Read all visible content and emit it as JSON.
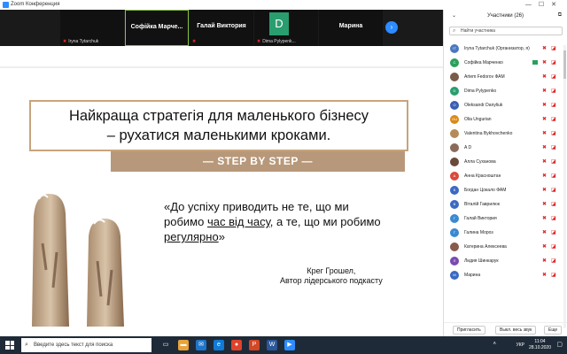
{
  "window": {
    "title": "Zoom Конференция"
  },
  "video_strip": {
    "tiles": [
      {
        "name": "",
        "sub": "Iryna Tytarchuk"
      },
      {
        "name": "Софійка Марче...",
        "sub": ""
      },
      {
        "name": "Галай Виктория",
        "sub": ""
      },
      {
        "name": "",
        "sub": "Dima Pylypenk...",
        "avatar": "D"
      },
      {
        "name": "Марина",
        "sub": ""
      }
    ],
    "next_icon": "›"
  },
  "slide": {
    "headline_line1": "Найкраща стратегія для маленького бізнесу",
    "headline_line2": "–  рухатися маленькими кроками.",
    "step_text": "— STEP BY STEP —",
    "quote_part1": "«До успіху приводить не те, що ми робимо ",
    "quote_u1": "час від часу",
    "quote_part2": ", а те, що ми робимо ",
    "quote_u2": "регулярно",
    "quote_part3": "»",
    "author_name": "Крег Грошел,",
    "author_title": "Автор лідерського подкасту"
  },
  "panel": {
    "title": "Участники (26)",
    "search_placeholder": "Найти участника",
    "participants": [
      {
        "initials": "IT",
        "name": "Iryna Tytarchuk (Организатор, я)",
        "color": "#4a78c2",
        "cam": false
      },
      {
        "initials": "С",
        "name": "Софійка Марченко",
        "color": "#2aa05b",
        "cam": true
      },
      {
        "initials": "",
        "name": "Artem Fedorov ФАМ",
        "color": "#7a5a48",
        "cam": false
      },
      {
        "initials": "D",
        "name": "Dima Pylypenko",
        "color": "#2a9d6f",
        "cam": false
      },
      {
        "initials": "O",
        "name": "Oleksandr Danyliuk",
        "color": "#3a5fb0",
        "cam": false
      },
      {
        "initials": "OU",
        "name": "Olia Ungurian",
        "color": "#d98a1a",
        "cam": false
      },
      {
        "initials": "",
        "name": "Valentina Bykhovchenko",
        "color": "#b58a5a",
        "cam": false
      },
      {
        "initials": "",
        "name": "A D",
        "color": "#8a6a5a",
        "cam": false
      },
      {
        "initials": "",
        "name": "Алла Суханова",
        "color": "#6a4a3a",
        "cam": false
      },
      {
        "initials": "А",
        "name": "Анна Красноштан",
        "color": "#d94a3a",
        "cam": false
      },
      {
        "initials": "Б",
        "name": "Богдан Цокало ФАМ",
        "color": "#3a6ac2",
        "cam": false
      },
      {
        "initials": "В",
        "name": "Віталій Гаврилюк",
        "color": "#3a6ac2",
        "cam": false
      },
      {
        "initials": "Г",
        "name": "Галай Виктория",
        "color": "#3a8ad2",
        "cam": false
      },
      {
        "initials": "Г",
        "name": "Галина Мороз",
        "color": "#3a8ad2",
        "cam": false
      },
      {
        "initials": "",
        "name": "Катерина Алексеева",
        "color": "#8a5a4a",
        "cam": false
      },
      {
        "initials": "Л",
        "name": "Лидия Шинкарук",
        "color": "#7a4ab0",
        "cam": false
      },
      {
        "initials": "М",
        "name": "Марина",
        "color": "#3a6ac2",
        "cam": false
      }
    ],
    "invite_label": "Пригласить",
    "mute_all_label": "Выкл. весь звук",
    "more_label": "Еще"
  },
  "taskbar": {
    "search_placeholder": "Введите здесь текст для поиска",
    "lang": "УКР",
    "time": "11:04",
    "date": "28.10.2020"
  }
}
